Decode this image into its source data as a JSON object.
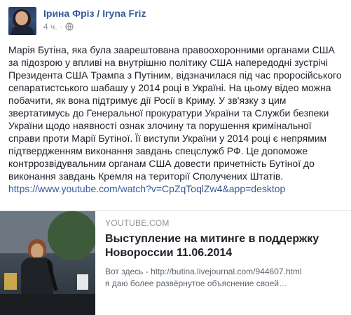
{
  "post": {
    "author": "Ірина Фріз / Iryna Friz",
    "time": "4 ч.",
    "separator": "·",
    "privacy_icon": "globe-icon",
    "avatar": "avatar-photo",
    "text_lines": [
      "Марія Бутіна, яка була заарештована правоохоронними органами США",
      "за підозрою у впливі на внутрішню політику США напередодні зустрічі",
      "Президента США Трампа з Путіним, відзначилася під час проросійського",
      "сепаратистського шабашу у 2014 році в Україні. На цьому відео можна",
      "побачити, як вона підтримує дії Росії в Криму. У зв'язку з цим",
      "звертатимусь до Генеральної прокуратури України та Служби безпеки",
      "України щодо наявності ознак злочину та порушення кримінальної",
      "справи проти Марії Бутіної. Її виступи України у 2014 році є непрямим",
      "підтвердженням виконання завдань спецслужб РФ. Це допоможе",
      "контррозвідувальним органам США довести причетність Бутіної до",
      "виконання завдань Кремля на території Сполучених Штатів."
    ],
    "link": "https://www.youtube.com/watch?v=CpZqToqlZw4&app=desktop"
  },
  "preview": {
    "site": "YOUTUBE.COM",
    "title_line1": "Выступление на митинге в поддержку",
    "title_line2": "Новороссии 11.06.2014",
    "desc_line1": "Вот здесь - http://butina.livejournal.com/944607.html",
    "desc_line2": "я даю более развёрнутое объяснение своей…",
    "thumbnail": "video-thumbnail"
  },
  "colors": {
    "author": "#365899",
    "link": "#365899",
    "meta": "#90949c",
    "text": "#1d2129",
    "border": "#dddfe2"
  }
}
